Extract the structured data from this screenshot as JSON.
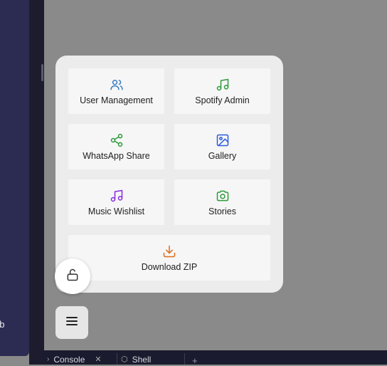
{
  "sidebar": {
    "truncated_text": "ob"
  },
  "bottom_tabs": [
    {
      "label": "Console"
    },
    {
      "label": "Shell"
    }
  ],
  "menu": {
    "items": [
      {
        "label": "User Management",
        "icon": "users-icon",
        "color": "#3a7bbf"
      },
      {
        "label": "Spotify Admin",
        "icon": "music-icon",
        "color": "#2e9b3a"
      },
      {
        "label": "WhatsApp Share",
        "icon": "share-icon",
        "color": "#2e9b3a"
      },
      {
        "label": "Gallery",
        "icon": "image-icon",
        "color": "#2b5be0"
      },
      {
        "label": "Music Wishlist",
        "icon": "music-icon",
        "color": "#8a2be2"
      },
      {
        "label": "Stories",
        "icon": "camera-icon",
        "color": "#2e9b3a"
      },
      {
        "label": "Download ZIP",
        "icon": "download-icon",
        "color": "#e06a1a"
      }
    ]
  },
  "lock_button": {
    "icon": "unlock-icon"
  },
  "menu_button": {
    "icon": "hamburger-icon"
  }
}
